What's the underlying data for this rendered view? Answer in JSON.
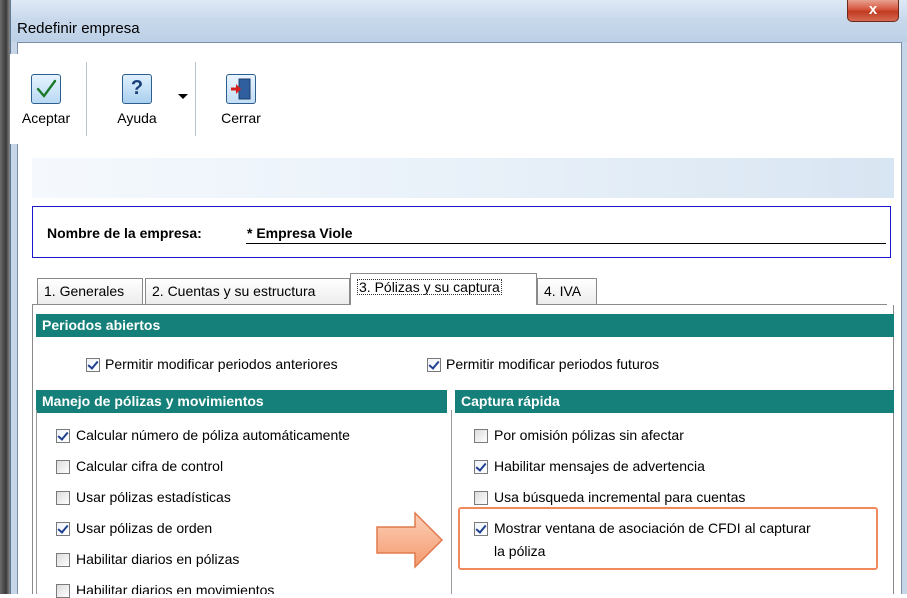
{
  "window": {
    "title": "Redefinir empresa",
    "close_glyph": "x"
  },
  "toolbar": {
    "accept_label": "Aceptar",
    "help_label": "Ayuda",
    "close_label": "Cerrar",
    "accept_icon": "checkmark-icon",
    "help_icon": "question-mark-icon",
    "close_icon": "exit-door-icon",
    "help_glyph": "?"
  },
  "company": {
    "label": "Nombre de la empresa:",
    "value": "* Empresa Viole"
  },
  "tabs": [
    {
      "label": "1. Generales",
      "active": false
    },
    {
      "label": "2. Cuentas y su estructura",
      "active": false
    },
    {
      "label": "3. Pólizas y su captura",
      "active": true
    },
    {
      "label": "4. IVA",
      "active": false
    }
  ],
  "sections": {
    "periodos": {
      "title": "Periodos abiertos",
      "items": [
        {
          "label": "Permitir modificar periodos anteriores",
          "checked": true
        },
        {
          "label": "Permitir modificar periodos futuros",
          "checked": true
        }
      ]
    },
    "manejo": {
      "title": "Manejo de pólizas y movimientos",
      "items": [
        {
          "label": "Calcular número de póliza automáticamente",
          "checked": true
        },
        {
          "label": "Calcular cifra de control",
          "checked": false
        },
        {
          "label": "Usar pólizas estadísticas",
          "checked": false
        },
        {
          "label": "Usar pólizas de orden",
          "checked": true
        },
        {
          "label": "Habilitar diarios en pólizas",
          "checked": false
        },
        {
          "label": "Habilitar diarios en movimientos",
          "checked": false
        }
      ]
    },
    "captura": {
      "title": "Captura rápida",
      "items": [
        {
          "label": "Por omisión pólizas sin afectar",
          "checked": false
        },
        {
          "label": "Habilitar mensajes de advertencia",
          "checked": true
        },
        {
          "label": "Usa búsqueda incremental para cuentas",
          "checked": false
        },
        {
          "label": "Mostrar ventana de asociación de CFDI al capturar",
          "label_line2": "la póliza",
          "checked": true
        }
      ]
    }
  },
  "colors": {
    "section_header": "#157f79",
    "highlight": "#f08a5d",
    "arrow_fill": "#f7a982"
  }
}
